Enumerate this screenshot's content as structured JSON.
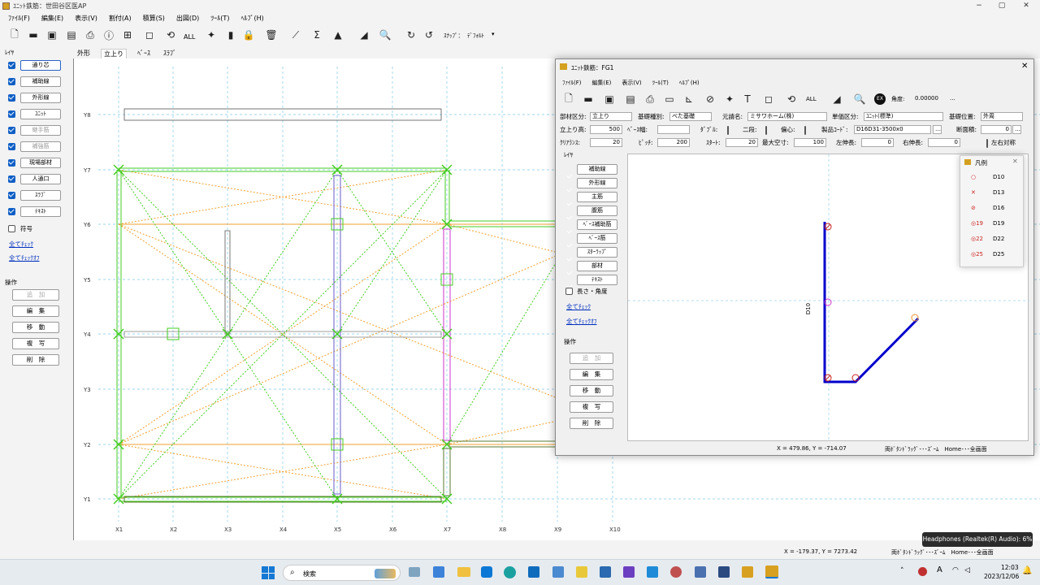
{
  "app": {
    "title": "ﾕﾆｯﾄ鉄筋：世田谷区医AP",
    "min": "−",
    "max": "▢",
    "close": "✕"
  },
  "menu": [
    "ﾌｧｲﾙ(F)",
    "編集(E)",
    "表示(V)",
    "割付(A)",
    "積算(S)",
    "出図(D)",
    "ﾂｰﾙ(T)",
    "ﾍﾙﾌﾟ(H)"
  ],
  "toolbar": {
    "all_label": "ALL",
    "snap_label": "ｽﾅｯﾌﾟ：",
    "snap_value": "ﾃﾞﾌｫﾙﾄ"
  },
  "view_tabs": [
    "外形",
    "立上り",
    "ﾍﾞｰｽ",
    "ｽﾗﾌﾞ"
  ],
  "left_panel": {
    "layer_title": "ﾚｲﾔ",
    "layers": [
      {
        "label": "通り芯",
        "checked": true,
        "dim": false,
        "selected": true
      },
      {
        "label": "補助線",
        "checked": true,
        "dim": false,
        "selected": false
      },
      {
        "label": "外形線",
        "checked": true,
        "dim": false,
        "selected": false
      },
      {
        "label": "ﾕﾆｯﾄ",
        "checked": true,
        "dim": false,
        "selected": false
      },
      {
        "label": "継手筋",
        "checked": true,
        "dim": true,
        "selected": false
      },
      {
        "label": "補強筋",
        "checked": true,
        "dim": true,
        "selected": false
      },
      {
        "label": "現場部材",
        "checked": true,
        "dim": false,
        "selected": false
      },
      {
        "label": "人通口",
        "checked": true,
        "dim": false,
        "selected": false
      },
      {
        "label": "ｽﾗﾌﾞ",
        "checked": true,
        "dim": false,
        "selected": false
      },
      {
        "label": "ﾃｷｽﾄ",
        "checked": true,
        "dim": false,
        "selected": false
      }
    ],
    "symbol_label": "符号",
    "check_all": "全てﾁｪｯｸ",
    "uncheck_all": "全てﾁｪｯｸｵﾌ",
    "ops_title": "操作",
    "ops": [
      {
        "label": "追　加",
        "dim": true
      },
      {
        "label": "編　集",
        "dim": false
      },
      {
        "label": "移　動",
        "dim": false
      },
      {
        "label": "複　写",
        "dim": false
      },
      {
        "label": "削　除",
        "dim": false
      }
    ]
  },
  "grid": {
    "y_labels": [
      "Y8",
      "Y7",
      "Y6",
      "Y5",
      "Y4",
      "Y3",
      "Y2",
      "Y1"
    ],
    "x_labels": [
      "X1",
      "X2",
      "X3",
      "X4",
      "X5",
      "X6",
      "X7",
      "X8",
      "X9",
      "X10"
    ]
  },
  "status_main": {
    "coords": "X = -179.37, Y = 7273.42",
    "hint": "両ﾎﾞﾀﾝﾄﾞﾗｯｸﾞ･･･ｽﾞｰﾑ　Home･･･全画面"
  },
  "sub": {
    "title": "ﾕﾆｯﾄ鉄筋：FG1",
    "close": "✕",
    "menu": [
      "ﾌｧｲﾙ(F)",
      "編集(E)",
      "表示(V)",
      "ﾂｰﾙ(T)",
      "ﾍﾙﾌﾟ(H)"
    ],
    "toolbar": {
      "all_label": "ALL",
      "angle_label": "角度:",
      "angle_value": "0.00000",
      "more": "..."
    },
    "form": {
      "buzai_label": "部材区分:",
      "buzai_value": "立上り",
      "kiso_label": "基礎種別:",
      "kiso_value": "べた基礎",
      "moto_label": "元請名:",
      "moto_value": "ミサワホーム(株)",
      "tanka_label": "単価区分:",
      "tanka_value": "ﾕﾆｯﾄ(標準)",
      "iti_label": "基礎位置:",
      "iti_value": "外周",
      "tachi_label": "立上り高:",
      "tachi_value": "500",
      "base_label": "ﾍﾞｰｽ幅:",
      "base_value": "",
      "double_label": "ﾀﾞﾌﾞﾙ:",
      "nidan_label": "二段:",
      "henshin_label": "偏心:",
      "code_label": "製品ｺｰﾄﾞ:",
      "code_value": "D16D31-3500x0",
      "dan_label": "断面積:",
      "dan_value": "0",
      "clear_label": "ｸﾘｱﾗﾝｽ:",
      "clear_value": "20",
      "pitch_label": "ﾋﾟｯﾁ:",
      "pitch_value": "200",
      "start_label": "ｽﾀｰﾄ:",
      "start_value": "20",
      "max_label": "最大空寸:",
      "max_value": "100",
      "left_label": "左伸長:",
      "left_value": "0",
      "right_label": "右伸長:",
      "right_value": "0",
      "sym_label": "左右対称"
    },
    "layer_title": "ﾚｲﾔ",
    "layers": [
      "補助線",
      "外形線",
      "主筋",
      "腹筋",
      "ﾍﾞｰｽ補助筋",
      "ﾍﾞｰｽ筋",
      "ｽﾀｰﾗｯﾌﾟ",
      "部材",
      "ﾃｷｽﾄ"
    ],
    "length_label": "長さ・角度",
    "check_all": "全てﾁｪｯｸ",
    "uncheck_all": "全てﾁｪｯｸｵﾌ",
    "ops_title": "操作",
    "ops": [
      {
        "label": "追　加",
        "dim": true
      },
      {
        "label": "編　集",
        "dim": false
      },
      {
        "label": "移　動",
        "dim": false
      },
      {
        "label": "複　写",
        "dim": false
      },
      {
        "label": "削　除",
        "dim": false
      }
    ],
    "dim_label": "D10",
    "status": {
      "coords": "X = 479.86, Y = -714.07",
      "hint": "両ﾎﾞﾀﾝﾄﾞﾗｯｸﾞ･･･ｽﾞｰﾑ　Home･･･全画面"
    }
  },
  "legend": {
    "title": "凡例",
    "close": "✕",
    "items": [
      {
        "symbol": "○",
        "label": "D10"
      },
      {
        "symbol": "✕",
        "label": "D13"
      },
      {
        "symbol": "⊘",
        "label": "D16"
      },
      {
        "symbol": "◎19",
        "label": "D19"
      },
      {
        "symbol": "◎22",
        "label": "D22"
      },
      {
        "symbol": "◎25",
        "label": "D25"
      }
    ]
  },
  "tooltip": "Headphones (Realtek(R) Audio): 6%",
  "taskbar": {
    "search": "検索",
    "time": "12:03",
    "date": "2023/12/06",
    "ime": "A"
  },
  "colors": {
    "green": "#44cc22",
    "orange": "#f0a030",
    "violet": "#6a5acd",
    "magenta": "#cc33cc",
    "blue": "#0000cc",
    "grid": "#80c8e8"
  }
}
